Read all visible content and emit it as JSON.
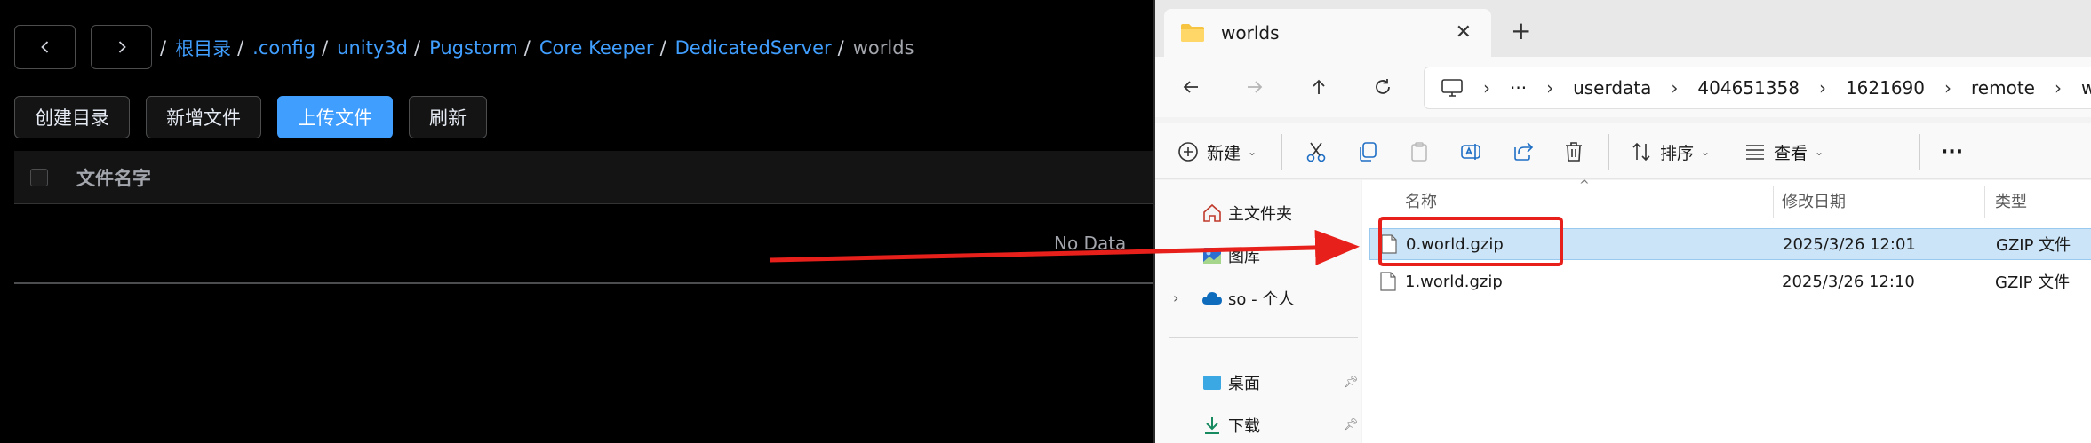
{
  "web": {
    "breadcrumb": {
      "separator": "/",
      "items": [
        "根目录",
        ".config",
        "unity3d",
        "Pugstorm",
        "Core Keeper",
        "DedicatedServer"
      ],
      "current": "worlds"
    },
    "actions": {
      "create_dir": "创建目录",
      "new_file": "新增文件",
      "upload": "上传文件",
      "refresh": "刷新"
    },
    "table": {
      "col_name": "文件名字",
      "empty_text": "No Data"
    },
    "colors": {
      "accent": "#409eff",
      "arrow": "#e8201b"
    }
  },
  "explorer": {
    "tab_title": "worlds",
    "tab_close": "✕",
    "tab_new": "+",
    "address": {
      "more": "···",
      "segments": [
        "userdata",
        "404651358",
        "1621690",
        "remote",
        "w"
      ]
    },
    "commands": {
      "new": "新建",
      "sort": "排序",
      "view": "查看",
      "more": "···"
    },
    "nav": {
      "home": "主文件夹",
      "gallery": "图库",
      "onedrive": "so - 个人",
      "desktop": "桌面",
      "downloads": "下载"
    },
    "columns": {
      "name": "名称",
      "modified": "修改日期",
      "type": "类型"
    },
    "files": [
      {
        "name": "0.world.gzip",
        "modified": "2025/3/26 12:01",
        "type": "GZIP 文件",
        "selected": true
      },
      {
        "name": "1.world.gzip",
        "modified": "2025/3/26 12:10",
        "type": "GZIP 文件",
        "selected": false
      }
    ]
  }
}
